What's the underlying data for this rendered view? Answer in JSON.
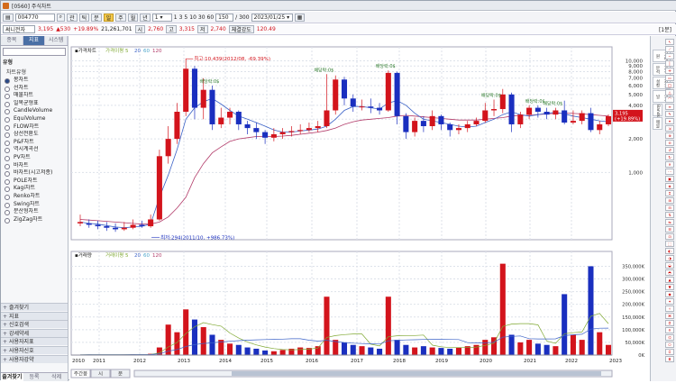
{
  "window": {
    "title": "[0560] 주식차트"
  },
  "toolbar1": {
    "code": "004770",
    "icon_labels": [
      "관",
      "틱",
      "분",
      "일",
      "주",
      "월",
      "년"
    ],
    "interval_value": "1",
    "interval_buttons": [
      "1",
      "3",
      "5",
      "10",
      "30",
      "60"
    ],
    "count_value": "150",
    "count_total": "/ 300",
    "date_value": "2023/01/25"
  },
  "toolbar2": {
    "name": "써니전자",
    "price": "3,195",
    "change": "▲530",
    "change_rate": "+19.89%",
    "volume": "21,261,701",
    "low_label": "시",
    "open_value": "2,760",
    "high_label": "고",
    "high_value": "3,315",
    "low2_label": "저",
    "low_value": "2,740",
    "strength_label": "체결강도",
    "strength_value": "120.49",
    "right_label": "[1분]"
  },
  "sidebar": {
    "tabs": [
      "종목",
      "지표",
      "시스템"
    ],
    "section": "유형",
    "subsection": "차트유형",
    "items": [
      "봉차트",
      "선차트",
      "매물차트",
      "일목균형표",
      "CandleVolume",
      "EquiVolume",
      "FLOW차트",
      "삼선전환도",
      "P&F차트",
      "역시계곡선",
      "PV차트",
      "바차트",
      "바차트(시고저종)",
      "POLE차트",
      "Kagi차트",
      "Renko차트",
      "Swing차트",
      "분산형차트",
      "ZigZag차트"
    ],
    "selected_index": 0,
    "groups": [
      "즐겨찾기",
      "지표",
      "신호검색",
      "강세약세",
      "사용자지표",
      "사용자신호",
      "사용자강약"
    ],
    "bottom_tabs": [
      "즐겨찾기",
      "등록",
      "삭제"
    ],
    "chart_tabs": [
      "주간봉",
      "시",
      "분"
    ]
  },
  "right_panel": {
    "vertical_labels": [
      "거래원",
      "가격분석",
      "지표설정",
      "시그널",
      "Bands",
      "매물"
    ]
  },
  "chart_data": {
    "type": "candlestick_with_volume",
    "x_labels": [
      "2010",
      "2011",
      "2012",
      "2013",
      "2014",
      "2015",
      "2016",
      "2017",
      "2018",
      "2019",
      "2020",
      "2021",
      "2022",
      "2023"
    ],
    "price_panel": {
      "legend": {
        "title": "가격차트",
        "ma_title": "가격이평",
        "periods": [
          "5",
          "20",
          "60",
          "120"
        ]
      },
      "y_ticks": [
        "10,000",
        "9,000",
        "8,000",
        "7,000",
        "6,000",
        "5,000",
        "4,000",
        "3,000",
        "2,000",
        "1,000"
      ],
      "ylim": [
        0,
        11000
      ],
      "y_scale": "log",
      "current_price_label": "3,195",
      "current_rate_label": "(+19.89%)",
      "annotations": {
        "high": "최고:10,439(2012/08, -69.39%)",
        "low": "최저:294(2011/10, +986.73%)",
        "dividend": "배당락:0$"
      },
      "colors": {
        "up": "#d3141c",
        "down": "#1a2fbf",
        "ma5": "#7fa832",
        "ma20": "#3b62c7",
        "ma60": "#4aa4c9",
        "ma120": "#b23b69"
      },
      "candles": [
        [
          350,
          360,
          420,
          330
        ],
        [
          350,
          340,
          380,
          320
        ],
        [
          340,
          330,
          370,
          310
        ],
        [
          330,
          320,
          360,
          300
        ],
        [
          320,
          310,
          350,
          294
        ],
        [
          310,
          320,
          360,
          300
        ],
        [
          320,
          340,
          380,
          310
        ],
        [
          340,
          330,
          370,
          320
        ],
        [
          330,
          380,
          420,
          320
        ],
        [
          380,
          1400,
          1600,
          370
        ],
        [
          1400,
          2000,
          2600,
          1200
        ],
        [
          2000,
          3500,
          4200,
          1800
        ],
        [
          3500,
          8500,
          10439,
          3200
        ],
        [
          8500,
          3800,
          9000,
          3000
        ],
        [
          3800,
          5500,
          7000,
          3000
        ],
        [
          5500,
          2700,
          6000,
          2400
        ],
        [
          2700,
          3100,
          3800,
          2500
        ],
        [
          3100,
          3500,
          3800,
          2700
        ],
        [
          3500,
          2700,
          3600,
          2400
        ],
        [
          2700,
          2500,
          2900,
          2200
        ],
        [
          2500,
          2300,
          2800,
          2000
        ],
        [
          2300,
          2050,
          2400,
          1800
        ],
        [
          2050,
          2200,
          2500,
          1900
        ],
        [
          2200,
          2300,
          2500,
          2000
        ],
        [
          2300,
          2350,
          2600,
          2100
        ],
        [
          2350,
          2400,
          2700,
          2200
        ],
        [
          2400,
          2500,
          2800,
          2300
        ],
        [
          2500,
          2600,
          2900,
          2300
        ],
        [
          2600,
          3600,
          7600,
          2500
        ],
        [
          3600,
          6800,
          7400,
          3300
        ],
        [
          6800,
          4600,
          7200,
          4000
        ],
        [
          4600,
          3900,
          5000,
          3500
        ],
        [
          3900,
          3900,
          4500,
          3600
        ],
        [
          3900,
          3800,
          4600,
          3400
        ],
        [
          3800,
          3600,
          4200,
          3300
        ],
        [
          3600,
          7800,
          8200,
          3500
        ],
        [
          7800,
          3200,
          8000,
          2700
        ],
        [
          3200,
          2300,
          3400,
          2000
        ],
        [
          2300,
          2900,
          3100,
          2100
        ],
        [
          2900,
          2600,
          3200,
          2300
        ],
        [
          2600,
          3200,
          3600,
          2400
        ],
        [
          3200,
          2700,
          3300,
          2400
        ],
        [
          2700,
          2400,
          2800,
          2100
        ],
        [
          2400,
          2500,
          2700,
          2200
        ],
        [
          2500,
          2700,
          2900,
          2300
        ],
        [
          2700,
          2900,
          3100,
          2600
        ],
        [
          2900,
          3600,
          4200,
          2800
        ],
        [
          3600,
          3700,
          4500,
          3200
        ],
        [
          3700,
          5000,
          5600,
          3400
        ],
        [
          5000,
          2700,
          5200,
          2300
        ],
        [
          2700,
          3300,
          3500,
          2500
        ],
        [
          3300,
          3800,
          4000,
          3000
        ],
        [
          3800,
          3500,
          4000,
          3100
        ],
        [
          3500,
          3300,
          3800,
          3000
        ],
        [
          3300,
          3600,
          3800,
          3000
        ],
        [
          3600,
          2800,
          4400,
          2700
        ],
        [
          2800,
          2900,
          3600,
          2700
        ],
        [
          2900,
          3400,
          3600,
          2700
        ],
        [
          3400,
          2400,
          3800,
          2300
        ],
        [
          2400,
          2700,
          2900,
          2200
        ],
        [
          2700,
          3195,
          3315,
          2600
        ]
      ],
      "ma": {
        "ma20": [
          360,
          350,
          345,
          335,
          325,
          320,
          325,
          330,
          345,
          600,
          950,
          1600,
          3000,
          3800,
          4300,
          4600,
          4100,
          3600,
          3200,
          3000,
          2800,
          2600,
          2400,
          2300,
          2300,
          2350,
          2400,
          2450,
          2600,
          3000,
          3600,
          3900,
          3900,
          3800,
          3700,
          4200,
          4400,
          4000,
          3400,
          3000,
          2900,
          2800,
          2700,
          2600,
          2550,
          2600,
          2800,
          3000,
          3300,
          3500,
          3300,
          3200,
          3300,
          3400,
          3450,
          3350,
          3200,
          3100,
          3000,
          2900,
          2850
        ],
        "ma120": [
          380,
          375,
          370,
          365,
          360,
          355,
          350,
          345,
          345,
          360,
          400,
          480,
          600,
          900,
          1200,
          1500,
          1700,
          1900,
          2000,
          2050,
          2100,
          2100,
          2100,
          2120,
          2150,
          2200,
          2250,
          2300,
          2380,
          2500,
          2700,
          2850,
          2950,
          3000,
          3050,
          3100,
          3200,
          3250,
          3200,
          3150,
          3100,
          3050,
          3000,
          2950,
          2950,
          2950,
          3000,
          3050,
          3100,
          3200,
          3250,
          3250,
          3300,
          3350,
          3380,
          3400,
          3380,
          3350,
          3300,
          3250,
          3200
        ]
      }
    },
    "volume_panel": {
      "legend": {
        "title": "거래량",
        "ma_title": "거래이평",
        "periods": [
          "5",
          "20",
          "60",
          "120"
        ]
      },
      "y_ticks": [
        "350,000K",
        "300,000K",
        "250,000K",
        "200,000K",
        "150,000K",
        "100,000K",
        "50,000K",
        "0K"
      ],
      "ylim": [
        0,
        380000
      ],
      "bar_unit": "K",
      "values": [
        1000,
        2000,
        1000,
        1500,
        1000,
        2000,
        3000,
        2000,
        5000,
        30000,
        120000,
        90000,
        180000,
        140000,
        110000,
        80000,
        60000,
        45000,
        40000,
        30000,
        25000,
        18000,
        15000,
        20000,
        25000,
        30000,
        28000,
        35000,
        230000,
        60000,
        50000,
        40000,
        35000,
        30000,
        25000,
        230000,
        60000,
        40000,
        30000,
        35000,
        30000,
        28000,
        25000,
        30000,
        35000,
        40000,
        60000,
        70000,
        360000,
        80000,
        50000,
        60000,
        45000,
        40000,
        35000,
        240000,
        80000,
        60000,
        350000,
        90000,
        40000
      ]
    }
  }
}
